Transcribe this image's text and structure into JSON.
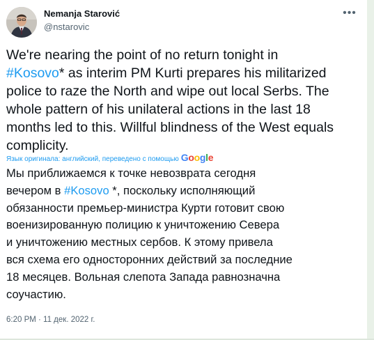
{
  "author": {
    "name": "Nemanja Starović",
    "handle": "@nstarovic"
  },
  "menu_icon": "more-horizontal-icon",
  "tweet": {
    "line1": "We're nearing the point of no return tonight in",
    "hashtag": "#Kosovo",
    "line2_rest": "* as interim PM Kurti prepares his militarized\npolice to raze the North and wipe out local Serbs. The\nwhole pattern of his unilateral actions in the last 18\nmonths led to this. Willful blindness of the West equals\ncomplicity."
  },
  "translation_notice": {
    "text": "Язык оригинала: английский, переведено с помощью",
    "provider": "Google"
  },
  "translated": {
    "line1": "Мы приближаемся к точке невозврата сегодня\nвечером в ",
    "hashtag": "#Kosovo",
    "rest": " *, поскольку исполняющий\nобязанности премьер-министра Курти готовит свою\nвоенизированную полицию к уничтожению Севера\nи уничтожению местных сербов. К этому привела\nвся схема его односторонних действий за последние\n18 месяцев. Вольная слепота Запада равнозначна\nсоучастию."
  },
  "timestamp": "6:20 PM · 11 дек. 2022 г.",
  "colors": {
    "link": "#1d9bf0",
    "text": "#0f1419",
    "secondary": "#536471"
  }
}
